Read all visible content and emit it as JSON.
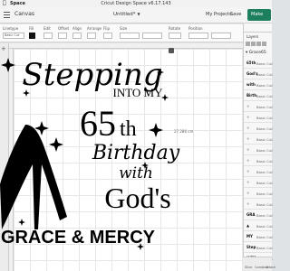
{
  "mac_menubar": {
    "app_name": "Space",
    "window_title": "Cricut Design Space v6.17.143"
  },
  "header": {
    "title": "Canvas",
    "project_name": "Untitled*",
    "my_projects": "My Projects",
    "save": "Save",
    "make": "Make"
  },
  "toolbar": {
    "labels": [
      "Linetype",
      "Fill",
      "Edit",
      "Offset",
      "Align",
      "Arrange",
      "Flip",
      "Size",
      "Rotate",
      "Position"
    ],
    "operation_value": "Basic Cut"
  },
  "canvas": {
    "dimension_label": "27.286 cm"
  },
  "design": {
    "line1": "Stepping",
    "line2": "INTO MY",
    "line3_num": "65",
    "line3_suffix": "th",
    "line4": "Birthday",
    "line5": "with",
    "line6": "God's",
    "line7": "GRACE & MERCY"
  },
  "layers_panel": {
    "title": "Layers",
    "group_name": "Grace65",
    "items": [
      {
        "thumb": "65th",
        "name": "Basic Cut"
      },
      {
        "thumb": "God's",
        "name": "Basic Cut"
      },
      {
        "thumb": "with",
        "name": "Basic Cut"
      },
      {
        "thumb": "Birth",
        "name": "Basic Cut"
      },
      {
        "thumb": "✧",
        "name": "Basic Cut"
      },
      {
        "thumb": "✧",
        "name": "Basic Cut"
      },
      {
        "thumb": "✧",
        "name": "Basic Cut"
      },
      {
        "thumb": "✧",
        "name": "Basic Cut"
      },
      {
        "thumb": "✧",
        "name": "Basic Cut"
      },
      {
        "thumb": "✧",
        "name": "Basic Cut"
      },
      {
        "thumb": "✧",
        "name": "Basic Cut"
      },
      {
        "thumb": "✧",
        "name": "Basic Cut"
      },
      {
        "thumb": "✧",
        "name": "Basic Cut"
      },
      {
        "thumb": "✧",
        "name": "Basic Cut"
      },
      {
        "thumb": "GRA",
        "name": "Basic Cut"
      },
      {
        "thumb": "▲",
        "name": "Basic Cut"
      },
      {
        "thumb": "MY",
        "name": "Basic Cut"
      },
      {
        "thumb": "Step",
        "name": "Basic Cut"
      },
      {
        "thumb": "INTO",
        "name": "Basic Cut"
      }
    ]
  },
  "bottom_bar": {
    "items": [
      "Slice",
      "Combine",
      "Attach"
    ]
  }
}
